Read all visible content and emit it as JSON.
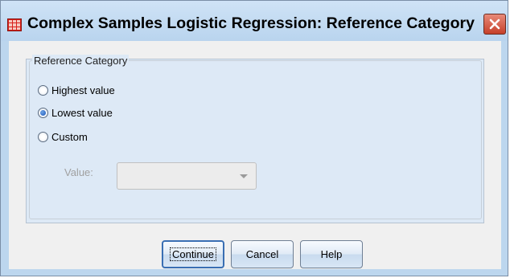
{
  "window": {
    "title": "Complex Samples Logistic Regression: Reference Category",
    "icon": "spss-table-icon"
  },
  "group": {
    "legend": "Reference Category",
    "options": [
      {
        "label": "Highest value",
        "checked": false
      },
      {
        "label": "Lowest value",
        "checked": true
      },
      {
        "label": "Custom",
        "checked": false
      }
    ]
  },
  "value_field": {
    "label": "Value:",
    "value": "",
    "enabled": false
  },
  "buttons": {
    "continue": "Continue",
    "cancel": "Cancel",
    "help": "Help"
  }
}
